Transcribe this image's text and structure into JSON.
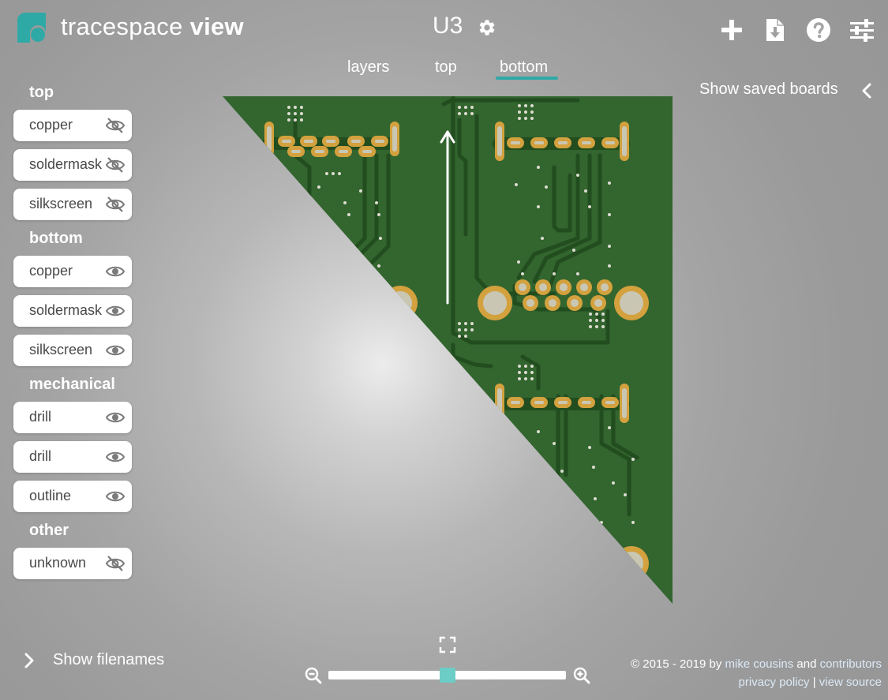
{
  "header": {
    "app_title_regular": "tracespace ",
    "app_title_bold": "view",
    "board_name": "U3",
    "actions": [
      {
        "name": "add-board-icon",
        "icon": "plus"
      },
      {
        "name": "download-icon",
        "icon": "file-download"
      },
      {
        "name": "help-icon",
        "icon": "question-circle"
      },
      {
        "name": "settings-sliders-icon",
        "icon": "sliders"
      }
    ]
  },
  "tabs": [
    {
      "label": "layers",
      "active": false
    },
    {
      "label": "top",
      "active": false
    },
    {
      "label": "bottom",
      "active": true
    }
  ],
  "saved_boards": {
    "label": "Show saved boards"
  },
  "sidebar": {
    "groups": [
      {
        "title": "top",
        "items": [
          {
            "label": "copper",
            "visible": false
          },
          {
            "label": "soldermask",
            "visible": false
          },
          {
            "label": "silkscreen",
            "visible": false
          }
        ]
      },
      {
        "title": "bottom",
        "items": [
          {
            "label": "copper",
            "visible": true
          },
          {
            "label": "soldermask",
            "visible": true
          },
          {
            "label": "silkscreen",
            "visible": true
          }
        ]
      },
      {
        "title": "mechanical",
        "items": [
          {
            "label": "drill",
            "visible": true
          },
          {
            "label": "drill",
            "visible": true
          },
          {
            "label": "outline",
            "visible": true
          }
        ]
      },
      {
        "title": "other",
        "items": [
          {
            "label": "unknown",
            "visible": false
          }
        ]
      }
    ]
  },
  "show_filenames": {
    "label": "Show filenames"
  },
  "zoom": {
    "level": 0.5
  },
  "footer": {
    "copyright": "© 2015 - 2019 by ",
    "author": "mike cousins",
    "and": " and ",
    "contributors": "contributors",
    "privacy": "privacy policy",
    "separator": " | ",
    "source": "view source"
  },
  "colors": {
    "accent": "#2fa9a6",
    "board_green": "#33652f",
    "trace_green": "#224d1f",
    "pad_gold": "#d3a13e",
    "pad_inner": "#c9c7b4"
  }
}
